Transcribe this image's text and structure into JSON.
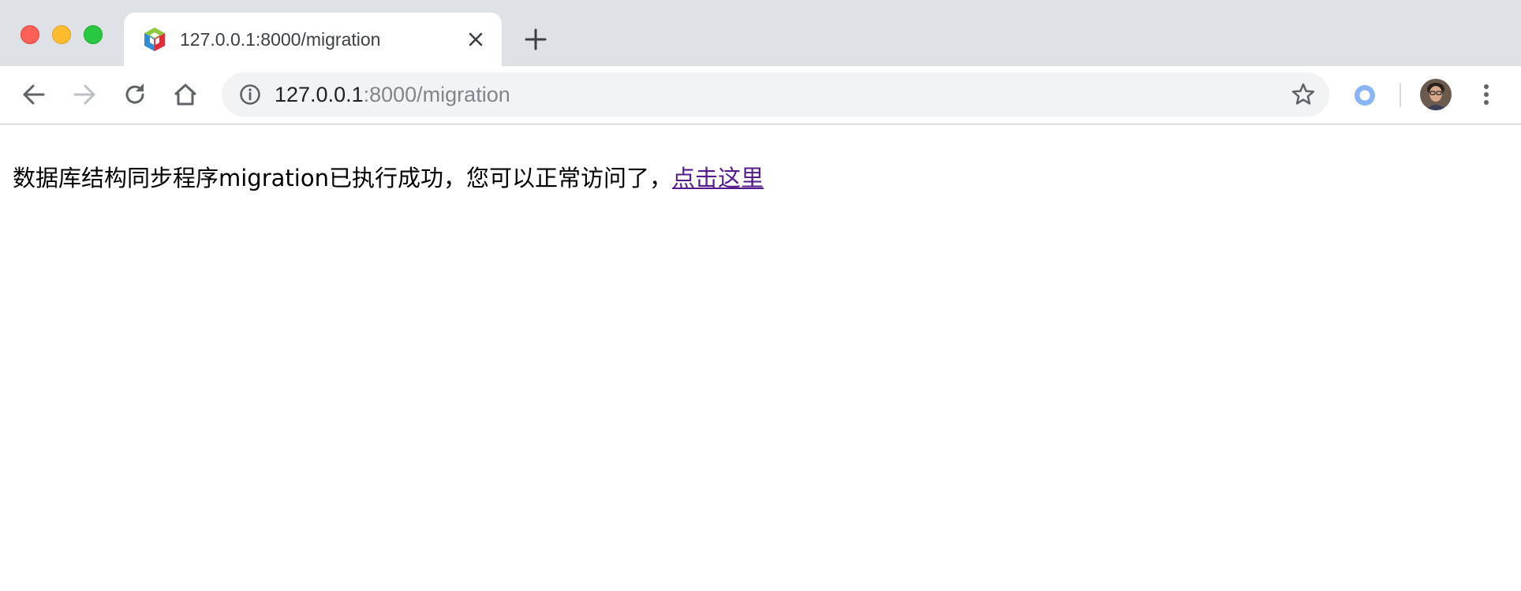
{
  "window": {
    "controls": [
      "close",
      "minimize",
      "maximize"
    ]
  },
  "tab": {
    "title": "127.0.0.1:8000/migration",
    "favicon": "yii-cube-icon",
    "close_icon": "close-icon"
  },
  "toolbar": {
    "back_icon": "arrow-left-icon",
    "forward_icon": "arrow-right-icon",
    "reload_icon": "reload-icon",
    "home_icon": "home-icon",
    "site_info_icon": "info-icon",
    "bookmark_icon": "star-icon",
    "extension_icon": "extension-ring-icon",
    "menu_icon": "kebab-menu-icon"
  },
  "address_bar": {
    "host": "127.0.0.1",
    "rest": ":8000/migration"
  },
  "page": {
    "message": "数据库结构同步程序migration已执行成功，您可以正常访问了，",
    "link_text": "点击这里"
  },
  "colors": {
    "tabstrip_bg": "#dee1e6",
    "omnibox_bg": "#f1f3f4",
    "visited_link": "#551a8b",
    "traffic_red": "#fe5f57",
    "traffic_yellow": "#febc2e",
    "traffic_green": "#28c840",
    "extension_blue": "#8ab4f8"
  }
}
